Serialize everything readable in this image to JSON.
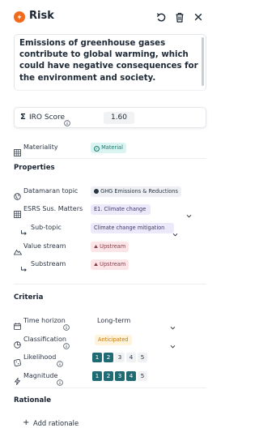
{
  "header": {
    "title": "Risk"
  },
  "statement": {
    "text": "Emissions of greenhouse gases contribute to global warming, which could have negative consequences for the environment and society."
  },
  "iro": {
    "sigma": "Σ",
    "label": "IRO Score",
    "value": "1.60"
  },
  "materiality": {
    "label": "Materiality",
    "value": "Material"
  },
  "properties": {
    "title": "Properties",
    "datamaran_topic": {
      "label": "Datamaran topic",
      "value": "GHG Emissions & Reductions"
    },
    "esrs": {
      "label": "ESRS Sus. Matters",
      "value": "E1. Climate change"
    },
    "subtopic": {
      "label": "Sub-topic",
      "value": "Climate change mitigation"
    },
    "value_stream": {
      "label": "Value stream",
      "value": "Upstream"
    },
    "substream": {
      "label": "Substream",
      "value": "Upstream"
    }
  },
  "criteria": {
    "title": "Criteria",
    "time_horizon": {
      "label": "Time horizon",
      "value": "Long-term"
    },
    "classification": {
      "label": "Classification",
      "value": "Anticipated"
    },
    "likelihood": {
      "label": "Likelihood",
      "options": [
        "1",
        "2",
        "3",
        "4",
        "5"
      ],
      "selected": 2
    },
    "magnitude": {
      "label": "Magnitude",
      "options": [
        "1",
        "2",
        "3",
        "4",
        "5"
      ],
      "selected": 4
    }
  },
  "rationale": {
    "title": "Rationale",
    "add_label": "Add rationale",
    "plus": "+"
  },
  "colors": {
    "brand": "#f26b1d",
    "scale_on": "#1f6b74",
    "material_bg": "#d9f4f1",
    "anticipated_text": "#c27a12"
  },
  "icons": {
    "header": [
      "undo-icon",
      "trash-icon",
      "close-icon"
    ]
  }
}
